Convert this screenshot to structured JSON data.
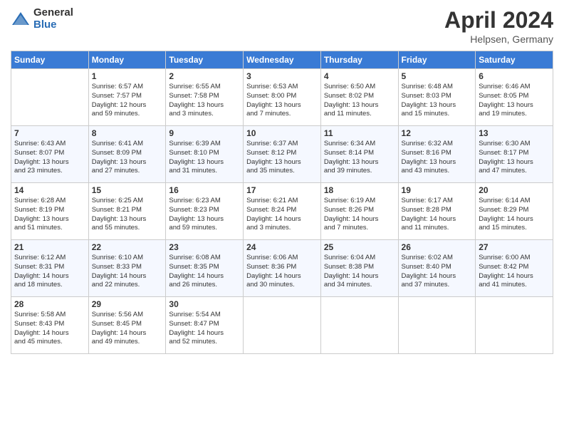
{
  "header": {
    "logo_general": "General",
    "logo_blue": "Blue",
    "month_year": "April 2024",
    "location": "Helpsen, Germany"
  },
  "days_of_week": [
    "Sunday",
    "Monday",
    "Tuesday",
    "Wednesday",
    "Thursday",
    "Friday",
    "Saturday"
  ],
  "weeks": [
    [
      {
        "num": "",
        "info": ""
      },
      {
        "num": "1",
        "info": "Sunrise: 6:57 AM\nSunset: 7:57 PM\nDaylight: 12 hours\nand 59 minutes."
      },
      {
        "num": "2",
        "info": "Sunrise: 6:55 AM\nSunset: 7:58 PM\nDaylight: 13 hours\nand 3 minutes."
      },
      {
        "num": "3",
        "info": "Sunrise: 6:53 AM\nSunset: 8:00 PM\nDaylight: 13 hours\nand 7 minutes."
      },
      {
        "num": "4",
        "info": "Sunrise: 6:50 AM\nSunset: 8:02 PM\nDaylight: 13 hours\nand 11 minutes."
      },
      {
        "num": "5",
        "info": "Sunrise: 6:48 AM\nSunset: 8:03 PM\nDaylight: 13 hours\nand 15 minutes."
      },
      {
        "num": "6",
        "info": "Sunrise: 6:46 AM\nSunset: 8:05 PM\nDaylight: 13 hours\nand 19 minutes."
      }
    ],
    [
      {
        "num": "7",
        "info": "Sunrise: 6:43 AM\nSunset: 8:07 PM\nDaylight: 13 hours\nand 23 minutes."
      },
      {
        "num": "8",
        "info": "Sunrise: 6:41 AM\nSunset: 8:09 PM\nDaylight: 13 hours\nand 27 minutes."
      },
      {
        "num": "9",
        "info": "Sunrise: 6:39 AM\nSunset: 8:10 PM\nDaylight: 13 hours\nand 31 minutes."
      },
      {
        "num": "10",
        "info": "Sunrise: 6:37 AM\nSunset: 8:12 PM\nDaylight: 13 hours\nand 35 minutes."
      },
      {
        "num": "11",
        "info": "Sunrise: 6:34 AM\nSunset: 8:14 PM\nDaylight: 13 hours\nand 39 minutes."
      },
      {
        "num": "12",
        "info": "Sunrise: 6:32 AM\nSunset: 8:16 PM\nDaylight: 13 hours\nand 43 minutes."
      },
      {
        "num": "13",
        "info": "Sunrise: 6:30 AM\nSunset: 8:17 PM\nDaylight: 13 hours\nand 47 minutes."
      }
    ],
    [
      {
        "num": "14",
        "info": "Sunrise: 6:28 AM\nSunset: 8:19 PM\nDaylight: 13 hours\nand 51 minutes."
      },
      {
        "num": "15",
        "info": "Sunrise: 6:25 AM\nSunset: 8:21 PM\nDaylight: 13 hours\nand 55 minutes."
      },
      {
        "num": "16",
        "info": "Sunrise: 6:23 AM\nSunset: 8:23 PM\nDaylight: 13 hours\nand 59 minutes."
      },
      {
        "num": "17",
        "info": "Sunrise: 6:21 AM\nSunset: 8:24 PM\nDaylight: 14 hours\nand 3 minutes."
      },
      {
        "num": "18",
        "info": "Sunrise: 6:19 AM\nSunset: 8:26 PM\nDaylight: 14 hours\nand 7 minutes."
      },
      {
        "num": "19",
        "info": "Sunrise: 6:17 AM\nSunset: 8:28 PM\nDaylight: 14 hours\nand 11 minutes."
      },
      {
        "num": "20",
        "info": "Sunrise: 6:14 AM\nSunset: 8:29 PM\nDaylight: 14 hours\nand 15 minutes."
      }
    ],
    [
      {
        "num": "21",
        "info": "Sunrise: 6:12 AM\nSunset: 8:31 PM\nDaylight: 14 hours\nand 18 minutes."
      },
      {
        "num": "22",
        "info": "Sunrise: 6:10 AM\nSunset: 8:33 PM\nDaylight: 14 hours\nand 22 minutes."
      },
      {
        "num": "23",
        "info": "Sunrise: 6:08 AM\nSunset: 8:35 PM\nDaylight: 14 hours\nand 26 minutes."
      },
      {
        "num": "24",
        "info": "Sunrise: 6:06 AM\nSunset: 8:36 PM\nDaylight: 14 hours\nand 30 minutes."
      },
      {
        "num": "25",
        "info": "Sunrise: 6:04 AM\nSunset: 8:38 PM\nDaylight: 14 hours\nand 34 minutes."
      },
      {
        "num": "26",
        "info": "Sunrise: 6:02 AM\nSunset: 8:40 PM\nDaylight: 14 hours\nand 37 minutes."
      },
      {
        "num": "27",
        "info": "Sunrise: 6:00 AM\nSunset: 8:42 PM\nDaylight: 14 hours\nand 41 minutes."
      }
    ],
    [
      {
        "num": "28",
        "info": "Sunrise: 5:58 AM\nSunset: 8:43 PM\nDaylight: 14 hours\nand 45 minutes."
      },
      {
        "num": "29",
        "info": "Sunrise: 5:56 AM\nSunset: 8:45 PM\nDaylight: 14 hours\nand 49 minutes."
      },
      {
        "num": "30",
        "info": "Sunrise: 5:54 AM\nSunset: 8:47 PM\nDaylight: 14 hours\nand 52 minutes."
      },
      {
        "num": "",
        "info": ""
      },
      {
        "num": "",
        "info": ""
      },
      {
        "num": "",
        "info": ""
      },
      {
        "num": "",
        "info": ""
      }
    ]
  ]
}
